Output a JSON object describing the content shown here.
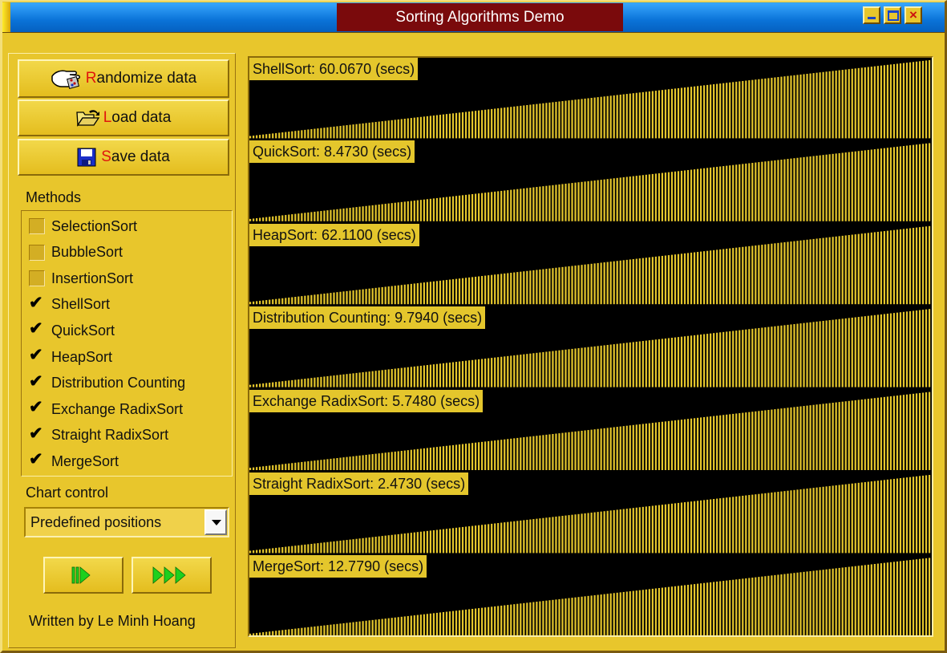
{
  "window": {
    "title": "Sorting Algorithms Demo",
    "controls": {
      "minimize_icon": "minimize-icon",
      "maximize_icon": "maximize-icon",
      "close_glyph": "×"
    }
  },
  "sidebar": {
    "buttons": {
      "randomize": {
        "hot": "R",
        "rest": "andomize data",
        "icon": "hand-dice-icon"
      },
      "load": {
        "hot": "L",
        "rest": "oad data",
        "icon": "open-folder-icon"
      },
      "save": {
        "hot": "S",
        "rest": "ave data",
        "icon": "floppy-disk-icon"
      }
    },
    "methods_label": "Methods",
    "methods": [
      {
        "label": "SelectionSort",
        "checked": false
      },
      {
        "label": "BubbleSort",
        "checked": false
      },
      {
        "label": "InsertionSort",
        "checked": false
      },
      {
        "label": "ShellSort",
        "checked": true
      },
      {
        "label": "QuickSort",
        "checked": true
      },
      {
        "label": "HeapSort",
        "checked": true
      },
      {
        "label": "Distribution Counting",
        "checked": true
      },
      {
        "label": "Exchange RadixSort",
        "checked": true
      },
      {
        "label": "Straight RadixSort",
        "checked": true
      },
      {
        "label": "MergeSort",
        "checked": true
      }
    ],
    "check_mark": "✔",
    "chart_control_label": "Chart control",
    "chart_control_value": "Predefined positions",
    "play_step_icon": "step-play-icon",
    "play_run_icon": "fast-forward-icon",
    "author": "Written by Le Minh Hoang"
  },
  "colors": {
    "panel": "#e8c62c",
    "bar": "#e4c62c",
    "chart_background": "#000000",
    "hotkey": "#e0150c",
    "title_bg": "#7a0a0c"
  },
  "chart_data": {
    "type": "bar",
    "series": [
      {
        "name": "ShellSort",
        "time_label": "ShellSort: 60.0670 (secs)"
      },
      {
        "name": "QuickSort",
        "time_label": "QuickSort: 8.4730 (secs)"
      },
      {
        "name": "HeapSort",
        "time_label": "HeapSort: 62.1100 (secs)"
      },
      {
        "name": "Distribution Counting",
        "time_label": "Distribution Counting: 9.7940 (secs)"
      },
      {
        "name": "Exchange RadixSort",
        "time_label": "Exchange RadixSort: 5.7480 (secs)"
      },
      {
        "name": "Straight RadixSort",
        "time_label": "Straight RadixSort: 2.4730 (secs)"
      },
      {
        "name": "MergeSort",
        "time_label": "MergeSort: 12.7790 (secs)"
      }
    ],
    "bars_per_series": 212,
    "values": "ascending (sorted), linear from min to max",
    "value_range": [
      0.03,
      1.0
    ]
  }
}
